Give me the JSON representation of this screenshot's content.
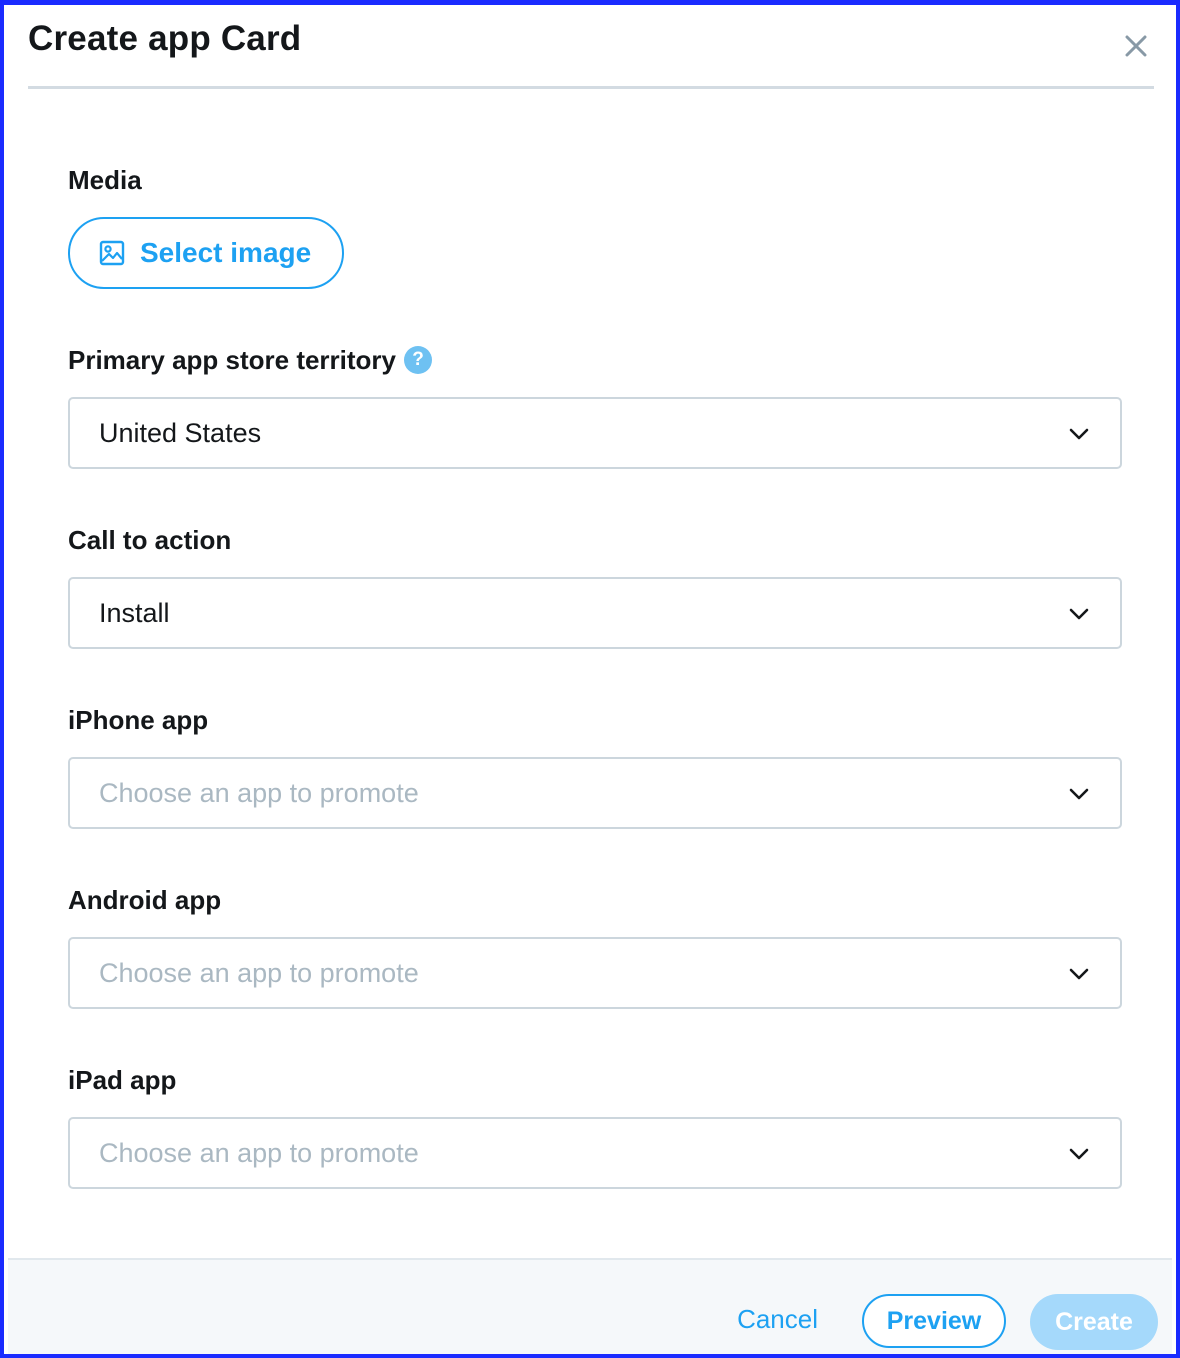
{
  "dialog": {
    "title": "Create app Card",
    "close_icon": "close-icon"
  },
  "media": {
    "label": "Media",
    "select_image_label": "Select image",
    "icon": "image-icon"
  },
  "territory": {
    "label": "Primary app store territory",
    "help_icon_glyph": "?",
    "value": "United States"
  },
  "call_to_action": {
    "label": "Call to action",
    "value": "Install"
  },
  "iphone_app": {
    "label": "iPhone app",
    "placeholder": "Choose an app to promote"
  },
  "android_app": {
    "label": "Android app",
    "placeholder": "Choose an app to promote"
  },
  "ipad_app": {
    "label": "iPad app",
    "placeholder": "Choose an app to promote"
  },
  "footer": {
    "cancel_label": "Cancel",
    "preview_label": "Preview",
    "create_label": "Create"
  },
  "colors": {
    "accent": "#1da1f2",
    "disabled_accent": "#a5d9fb",
    "placeholder": "#aab8c2",
    "border": "#ccd6dd",
    "frame": "#1a2bff"
  }
}
